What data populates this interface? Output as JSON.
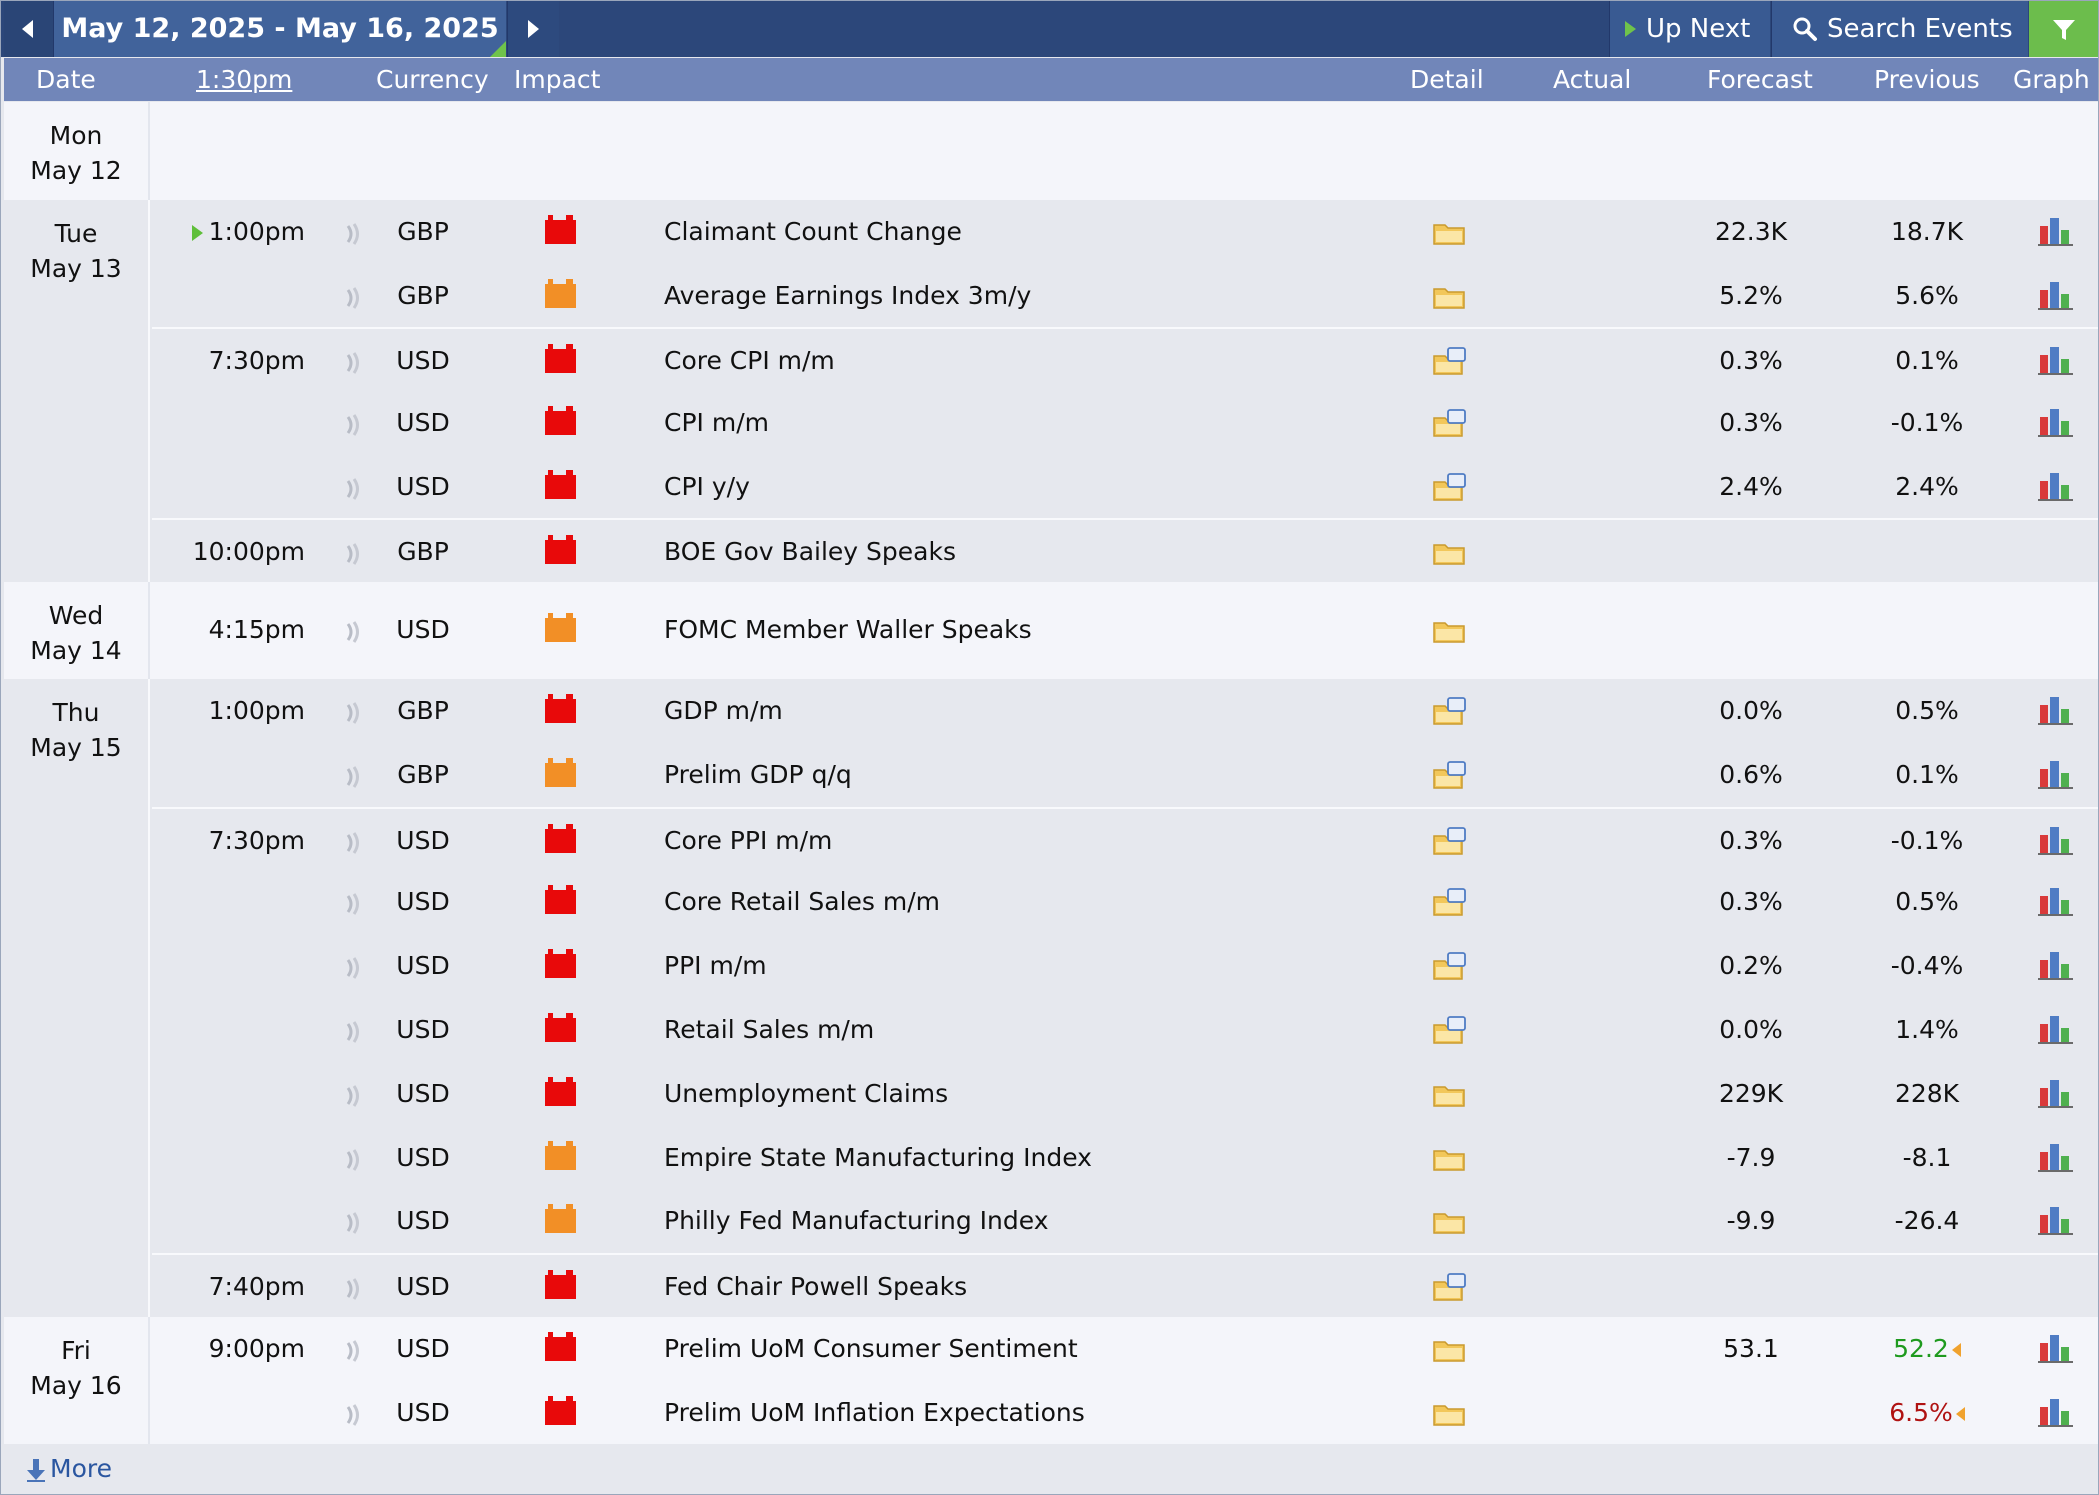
{
  "nav": {
    "date_range": "May 12, 2025 - May 16, 2025",
    "up_next_label": "Up Next",
    "search_label": "Search Events"
  },
  "columns": {
    "date": "Date",
    "time": "1:30pm",
    "currency": "Currency",
    "impact": "Impact",
    "detail": "Detail",
    "actual": "Actual",
    "forecast": "Forecast",
    "previous": "Previous",
    "graph": "Graph"
  },
  "days": [
    {
      "dow": "Mon",
      "date": "May 12",
      "events": []
    },
    {
      "dow": "Tue",
      "date": "May 13",
      "events": [
        {
          "time": "1:00pm",
          "currency": "GBP",
          "impact": "red",
          "name": "Claimant Count Change",
          "forecast": "22.3K",
          "previous": "18.7K"
        },
        {
          "time": "",
          "currency": "GBP",
          "impact": "orange",
          "name": "Average Earnings Index 3m/y",
          "forecast": "5.2%",
          "previous": "5.6%"
        },
        {
          "time": "7:30pm",
          "currency": "USD",
          "impact": "red",
          "name": "Core CPI m/m",
          "forecast": "0.3%",
          "previous": "0.1%"
        },
        {
          "time": "",
          "currency": "USD",
          "impact": "red",
          "name": "CPI m/m",
          "forecast": "0.3%",
          "previous": "-0.1%"
        },
        {
          "time": "",
          "currency": "USD",
          "impact": "red",
          "name": "CPI y/y",
          "forecast": "2.4%",
          "previous": "2.4%"
        },
        {
          "time": "10:00pm",
          "currency": "GBP",
          "impact": "red",
          "name": "BOE Gov Bailey Speaks",
          "forecast": "",
          "previous": ""
        }
      ]
    },
    {
      "dow": "Wed",
      "date": "May 14",
      "events": [
        {
          "time": "4:15pm",
          "currency": "USD",
          "impact": "orange",
          "name": "FOMC Member Waller Speaks",
          "forecast": "",
          "previous": ""
        }
      ]
    },
    {
      "dow": "Thu",
      "date": "May 15",
      "events": [
        {
          "time": "1:00pm",
          "currency": "GBP",
          "impact": "red",
          "name": "GDP m/m",
          "forecast": "0.0%",
          "previous": "0.5%"
        },
        {
          "time": "",
          "currency": "GBP",
          "impact": "orange",
          "name": "Prelim GDP q/q",
          "forecast": "0.6%",
          "previous": "0.1%"
        },
        {
          "time": "7:30pm",
          "currency": "USD",
          "impact": "red",
          "name": "Core PPI m/m",
          "forecast": "0.3%",
          "previous": "-0.1%"
        },
        {
          "time": "",
          "currency": "USD",
          "impact": "red",
          "name": "Core Retail Sales m/m",
          "forecast": "0.3%",
          "previous": "0.5%"
        },
        {
          "time": "",
          "currency": "USD",
          "impact": "red",
          "name": "PPI m/m",
          "forecast": "0.2%",
          "previous": "-0.4%"
        },
        {
          "time": "",
          "currency": "USD",
          "impact": "red",
          "name": "Retail Sales m/m",
          "forecast": "0.0%",
          "previous": "1.4%"
        },
        {
          "time": "",
          "currency": "USD",
          "impact": "red",
          "name": "Unemployment Claims",
          "forecast": "229K",
          "previous": "228K"
        },
        {
          "time": "",
          "currency": "USD",
          "impact": "orange",
          "name": "Empire State Manufacturing Index",
          "forecast": "-7.9",
          "previous": "-8.1"
        },
        {
          "time": "",
          "currency": "USD",
          "impact": "orange",
          "name": "Philly Fed Manufacturing Index",
          "forecast": "-9.9",
          "previous": "-26.4"
        },
        {
          "time": "7:40pm",
          "currency": "USD",
          "impact": "red",
          "name": "Fed Chair Powell Speaks",
          "forecast": "",
          "previous": ""
        }
      ]
    },
    {
      "dow": "Fri",
      "date": "May 16",
      "events": [
        {
          "time": "9:00pm",
          "currency": "USD",
          "impact": "red",
          "name": "Prelim UoM Consumer Sentiment",
          "forecast": "53.1",
          "previous": "52.2"
        },
        {
          "time": "",
          "currency": "USD",
          "impact": "red",
          "name": "Prelim UoM Inflation Expectations",
          "forecast": "",
          "previous": "6.5%"
        }
      ]
    }
  ],
  "more_label": "More"
}
